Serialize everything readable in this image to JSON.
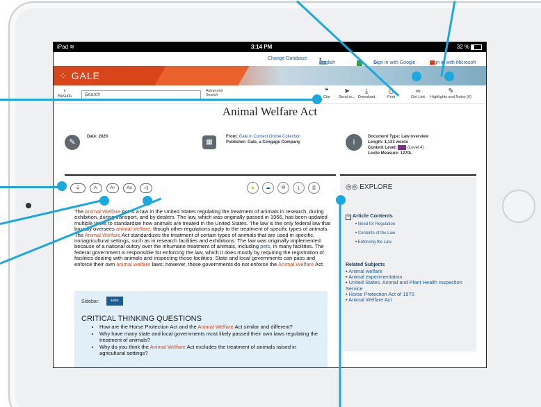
{
  "status": {
    "device": "iPad",
    "wifi_icon": "wifi-icon",
    "time": "3:14 PM",
    "battery": "32 %"
  },
  "topnav": {
    "change_db": "Change Database",
    "language": "English",
    "google": "Sign in with Google",
    "microsoft": "Sign in with Microsoft"
  },
  "brand": {
    "logo": "GALE"
  },
  "toolbar": {
    "back": "Results",
    "search_placeholder": "Search",
    "advanced": "Advanced Search",
    "tools": [
      {
        "label": "Cite",
        "icon": "cite-icon"
      },
      {
        "label": "Send to...",
        "icon": "send-icon"
      },
      {
        "label": "Download",
        "icon": "download-icon"
      },
      {
        "label": "Print",
        "icon": "print-icon"
      },
      {
        "label": "Get Link",
        "icon": "link-icon"
      },
      {
        "label": "Highlights and Notes (0)",
        "icon": "highlight-icon"
      }
    ]
  },
  "article": {
    "title": "Animal Welfare Act",
    "date": "Date: 2020",
    "from_label": "From:",
    "from": "Gale In Context Online Collection",
    "publisher": "Publisher: Gale, a Cengage Company",
    "doc_type": "Document Type: Law overview",
    "length": "Length: 1,133 words",
    "content_level": "Content Level:",
    "content_level_value": "(Level 4)",
    "lexile": "Lexile Measure: 1270L",
    "body_p1": "The ",
    "body_hl1": "Animal Welfare",
    "body_p2": " Act is a law in the United States regulating the treatment of animals in research, during exhibition, during transport, and by dealers. The law, which was originally passed in 1966, has been updated multiple times to standardize how animals are treated in the United States. The law is the only federal law that broadly oversees ",
    "body_hl2": "animal welfare",
    "body_p3": ", though other regulations apply to the treatment of specific types of animals. The ",
    "body_hl3": "Animal Welfare",
    "body_p4": " Act standardizes the treatment of certain types of animals that are used in specific, nonagricultural settings, such as in research facilities and exhibitions. The law was originally implemented because of a national outcry over the inhumane treatment of animals, including ",
    "body_link": "pets",
    "body_p5": ", in many facilities. The federal government is responsible for enforcing the law, which it does mostly by requiring the registration of facilities dealing with animals and inspecting those facilities. State and local governments can pass and enforce their own ",
    "body_hl4": "animal welfare",
    "body_p6": " laws; however, these governments do not enforce the ",
    "body_hl5": "Animal Welfare",
    "body_p7": " Act."
  },
  "accessibility": [
    "A-",
    "A+",
    "Aα"
  ],
  "sidebar": {
    "label": "Sidebar:",
    "hide": "Hide",
    "heading": "CRITICAL THINKING QUESTIONS",
    "q1a": "How are the Horse Protection Act and the ",
    "q1b": "Animal Welfare",
    "q1c": " Act similar and different?",
    "q2": "Why have many state and local governments most likely passed their own laws regulating the treatment of animals?",
    "q3a": "Why do you think the ",
    "q3b": "Animal Welfare",
    "q3c": " Act excludes the treatment of animals raised in agricultural settings?"
  },
  "explore": {
    "heading": "EXPLORE",
    "contents_heading": "Article Contents",
    "toc": [
      "Need for Regulation",
      "Contents of the Law",
      "Enforcing the Law"
    ],
    "related_heading": "Related Subjects",
    "subjects": [
      "Animal welfare",
      "Animal experimentation",
      "United States. Animal and Plant Health Inspection Service",
      "Horse Protection Act of 1970",
      "Animal Welfare Act"
    ]
  },
  "colors": {
    "accent": "#1aa8de",
    "brand": "#d9451b",
    "link": "#1a5a96"
  }
}
